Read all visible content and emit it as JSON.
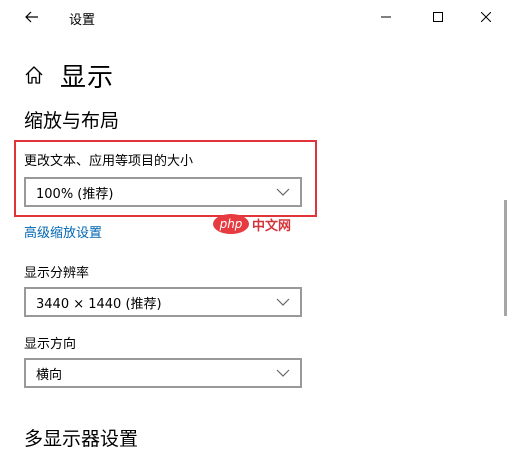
{
  "window": {
    "title": "设置"
  },
  "page": {
    "title": "显示"
  },
  "scale_section": {
    "title": "缩放与布局",
    "text_size_label": "更改文本、应用等项目的大小",
    "text_size_value": "100% (推荐)",
    "advanced_link": "高级缩放设置",
    "resolution_label": "显示分辨率",
    "resolution_value": "3440 × 1440 (推荐)",
    "orientation_label": "显示方向",
    "orientation_value": "横向"
  },
  "multi_section": {
    "title": "多显示器设置"
  },
  "watermark": {
    "logo": "php",
    "text": "中文网"
  },
  "colors": {
    "highlight": "#e0343a",
    "link": "#0066b4",
    "dropdown_border": "#999999"
  },
  "icons": {
    "back": "back-arrow-icon",
    "minimize": "minimize-icon",
    "maximize": "maximize-icon",
    "close": "close-icon",
    "home": "home-icon",
    "chevron": "chevron-down-icon"
  }
}
